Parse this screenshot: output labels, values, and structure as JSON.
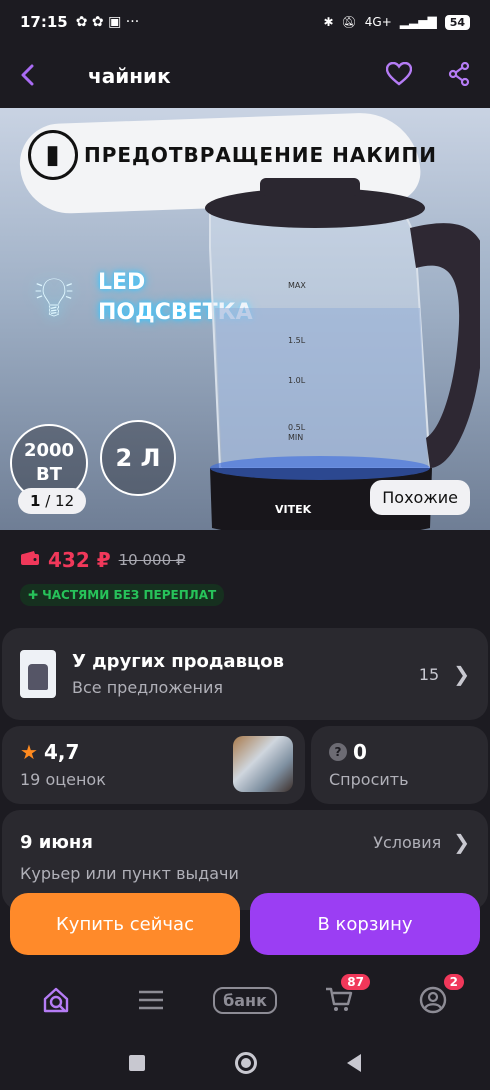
{
  "status": {
    "time": "17:15",
    "left_icons": "✿ ✿ ▣ ···",
    "network": "4G+",
    "battery": "54"
  },
  "appbar": {
    "title": "чайник"
  },
  "hero": {
    "banner": "ПРЕДОТВРАЩЕНИЕ НАКИПИ",
    "led_line1": "LED",
    "led_line2": "ПОДСВЕТКА",
    "power_value": "2000",
    "power_unit": "ВТ",
    "volume": "2 Л",
    "pager_current": "1",
    "pager_total": "/ 12",
    "similar_label": "Похожие",
    "brand": "VITEK",
    "marks": [
      "MAX",
      "1.5L",
      "1.0L",
      "0.5L",
      "MIN"
    ]
  },
  "price": {
    "current": "432 ₽",
    "old": "10 000 ₽",
    "installments": "ЧАСТЯМИ БЕЗ ПЕРЕПЛАТ"
  },
  "sellers": {
    "title": "У других продавцов",
    "subtitle": "Все предложения",
    "count": "15"
  },
  "rating": {
    "value": "4,7",
    "reviews": "19 оценок"
  },
  "questions": {
    "count": "0",
    "label": "Спросить"
  },
  "delivery": {
    "date": "9 июня",
    "terms": "Условия",
    "method": "Курьер или пункт выдачи"
  },
  "actions": {
    "buy_now": "Купить сейчас",
    "add_to_cart": "В корзину"
  },
  "tabs": {
    "bank_label": "банк",
    "cart_badge": "87",
    "profile_badge": "2"
  },
  "colors": {
    "accent": "#9b3ef3",
    "price": "#f0385a",
    "buy": "#ff8a2a",
    "installments": "#27c25a"
  }
}
